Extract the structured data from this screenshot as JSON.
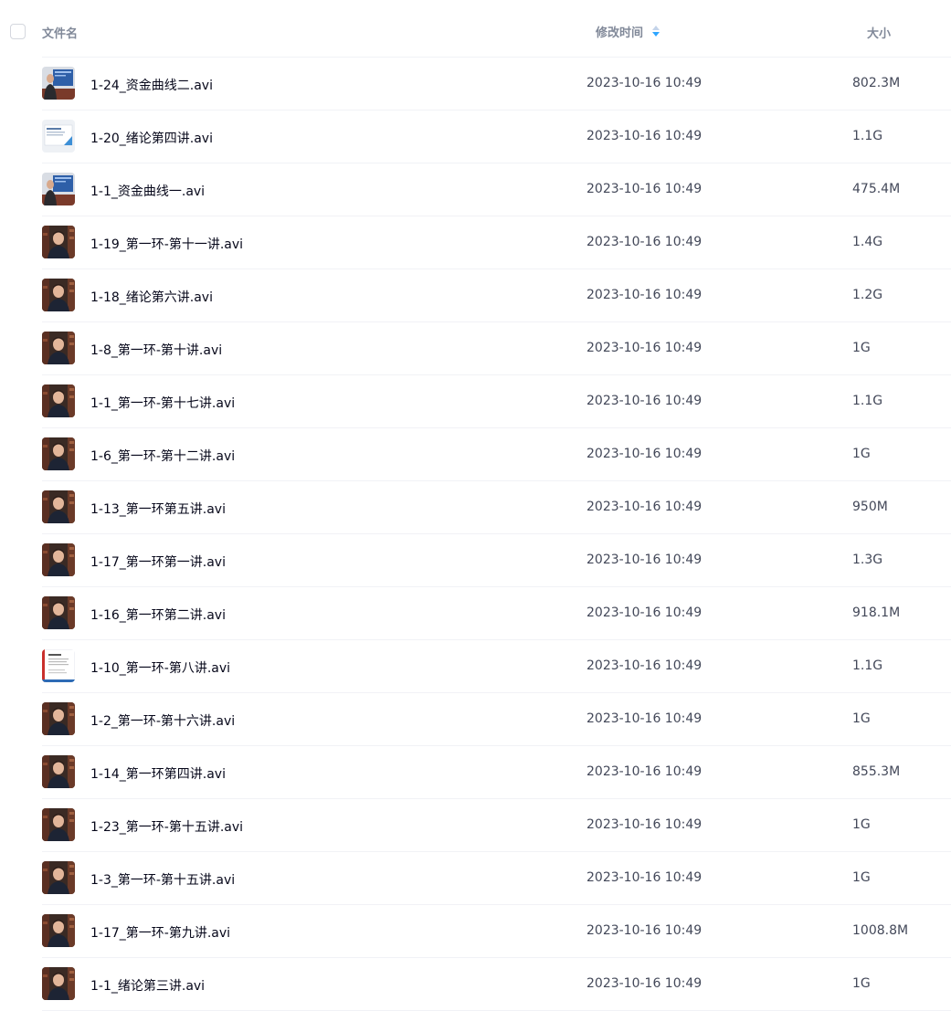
{
  "header": {
    "name_label": "文件名",
    "time_label": "修改时间",
    "size_label": "大小",
    "sort_accent": "#2fa6ff"
  },
  "files": [
    {
      "name": "1-24_资金曲线二.avi",
      "time": "2023-10-16 10:49",
      "size": "802.3M",
      "thumb": "presenter-screen-thumbnail"
    },
    {
      "name": "1-20_绪论第四讲.avi",
      "time": "2023-10-16 10:49",
      "size": "1.1G",
      "thumb": "slide-thumbnail"
    },
    {
      "name": "1-1_资金曲线一.avi",
      "time": "2023-10-16 10:49",
      "size": "475.4M",
      "thumb": "presenter-screen-thumbnail"
    },
    {
      "name": "1-19_第一环-第十一讲.avi",
      "time": "2023-10-16 10:49",
      "size": "1.4G",
      "thumb": "speaker-thumbnail"
    },
    {
      "name": "1-18_绪论第六讲.avi",
      "time": "2023-10-16 10:49",
      "size": "1.2G",
      "thumb": "speaker-thumbnail"
    },
    {
      "name": "1-8_第一环-第十讲.avi",
      "time": "2023-10-16 10:49",
      "size": "1G",
      "thumb": "speaker-thumbnail"
    },
    {
      "name": "1-1_第一环-第十七讲.avi",
      "time": "2023-10-16 10:49",
      "size": "1.1G",
      "thumb": "speaker-thumbnail"
    },
    {
      "name": "1-6_第一环-第十二讲.avi",
      "time": "2023-10-16 10:49",
      "size": "1G",
      "thumb": "speaker-thumbnail"
    },
    {
      "name": "1-13_第一环第五讲.avi",
      "time": "2023-10-16 10:49",
      "size": "950M",
      "thumb": "speaker-thumbnail"
    },
    {
      "name": "1-17_第一环第一讲.avi",
      "time": "2023-10-16 10:49",
      "size": "1.3G",
      "thumb": "speaker-thumbnail"
    },
    {
      "name": "1-16_第一环第二讲.avi",
      "time": "2023-10-16 10:49",
      "size": "918.1M",
      "thumb": "speaker-thumbnail"
    },
    {
      "name": "1-10_第一环-第八讲.avi",
      "time": "2023-10-16 10:49",
      "size": "1.1G",
      "thumb": "document-thumbnail"
    },
    {
      "name": "1-2_第一环-第十六讲.avi",
      "time": "2023-10-16 10:49",
      "size": "1G",
      "thumb": "speaker-thumbnail"
    },
    {
      "name": "1-14_第一环第四讲.avi",
      "time": "2023-10-16 10:49",
      "size": "855.3M",
      "thumb": "speaker-thumbnail"
    },
    {
      "name": "1-23_第一环-第十五讲.avi",
      "time": "2023-10-16 10:49",
      "size": "1G",
      "thumb": "speaker-thumbnail"
    },
    {
      "name": "1-3_第一环-第十五讲.avi",
      "time": "2023-10-16 10:49",
      "size": "1G",
      "thumb": "speaker-thumbnail"
    },
    {
      "name": "1-17_第一环-第九讲.avi",
      "time": "2023-10-16 10:49",
      "size": "1008.8M",
      "thumb": "speaker-thumbnail"
    },
    {
      "name": "1-1_绪论第三讲.avi",
      "time": "2023-10-16 10:49",
      "size": "1G",
      "thumb": "speaker-thumbnail"
    }
  ]
}
